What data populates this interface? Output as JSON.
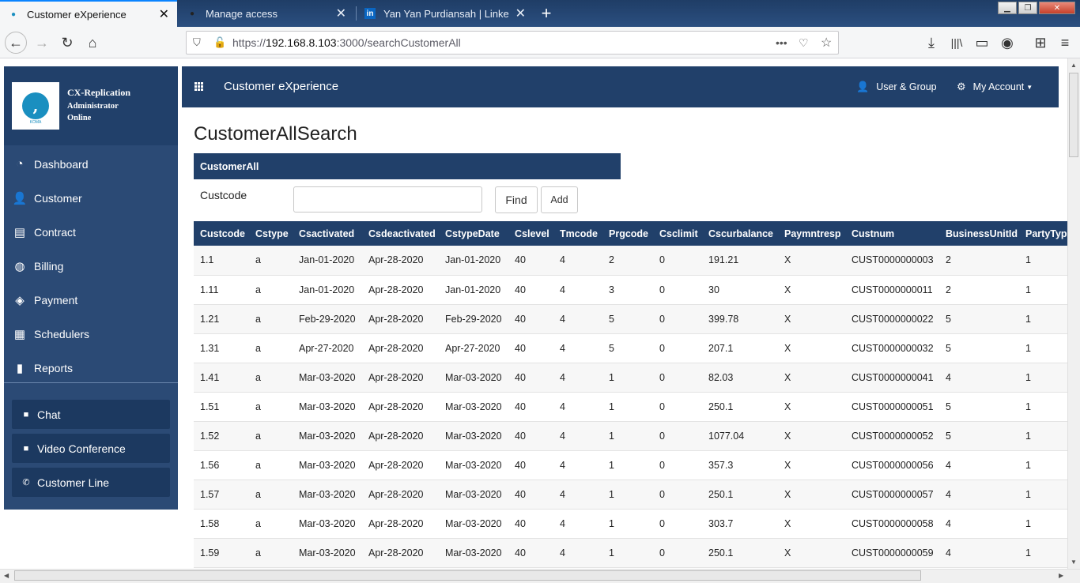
{
  "browser": {
    "tabs": [
      {
        "title": "Customer eXperience",
        "active": true
      },
      {
        "title": "Manage access",
        "active": false
      },
      {
        "title": "Yan Yan Purdiansah | LinkedIn",
        "active": false
      }
    ],
    "url_scheme": "https://",
    "url_host": "192.168.8.103",
    "url_path": ":3000/searchCustomerAll",
    "new_tab": "+"
  },
  "profile": {
    "name": "CX-Replication",
    "role": "Administrator",
    "status": "Online",
    "logo_mark": ",",
    "logo_text": "KOMA"
  },
  "sidebar": {
    "items": [
      {
        "label": "Dashboard",
        "icon": "dashboard-icon"
      },
      {
        "label": "Customer",
        "icon": "user-icon"
      },
      {
        "label": "Contract",
        "icon": "contract-icon"
      },
      {
        "label": "Billing",
        "icon": "globe-icon"
      },
      {
        "label": "Payment",
        "icon": "tags-icon"
      },
      {
        "label": "Schedulers",
        "icon": "calendar-icon"
      },
      {
        "label": "Reports",
        "icon": "bar-chart-icon"
      }
    ],
    "comm": [
      {
        "label": "Chat",
        "icon": "chat-icon"
      },
      {
        "label": "Video Conference",
        "icon": "video-icon"
      },
      {
        "label": "Customer Line",
        "icon": "phone-icon"
      }
    ]
  },
  "header": {
    "app_title": "Customer eXperience",
    "user_group": "User & Group",
    "my_account": "My Account"
  },
  "main": {
    "title": "CustomerAllSearch",
    "panel_title": "CustomerAll",
    "search_label": "Custcode",
    "search_value": "",
    "find_label": "Find",
    "add_label": "Add"
  },
  "table": {
    "columns": [
      "Custcode",
      "Cstype",
      "Csactivated",
      "Csdeactivated",
      "CstypeDate",
      "Cslevel",
      "Tmcode",
      "Prgcode",
      "Csclimit",
      "Cscurbalance",
      "Paymntresp",
      "Custnum",
      "BusinessUnitId",
      "PartyType"
    ],
    "rows": [
      [
        "1.1",
        "a",
        "Jan-01-2020",
        "Apr-28-2020",
        "Jan-01-2020",
        "40",
        "4",
        "2",
        "0",
        "191.21",
        "X",
        "CUST0000000003",
        "2",
        "1"
      ],
      [
        "1.11",
        "a",
        "Jan-01-2020",
        "Apr-28-2020",
        "Jan-01-2020",
        "40",
        "4",
        "3",
        "0",
        "30",
        "X",
        "CUST0000000011",
        "2",
        "1"
      ],
      [
        "1.21",
        "a",
        "Feb-29-2020",
        "Apr-28-2020",
        "Feb-29-2020",
        "40",
        "4",
        "5",
        "0",
        "399.78",
        "X",
        "CUST0000000022",
        "5",
        "1"
      ],
      [
        "1.31",
        "a",
        "Apr-27-2020",
        "Apr-28-2020",
        "Apr-27-2020",
        "40",
        "4",
        "5",
        "0",
        "207.1",
        "X",
        "CUST0000000032",
        "5",
        "1"
      ],
      [
        "1.41",
        "a",
        "Mar-03-2020",
        "Apr-28-2020",
        "Mar-03-2020",
        "40",
        "4",
        "1",
        "0",
        "82.03",
        "X",
        "CUST0000000041",
        "4",
        "1"
      ],
      [
        "1.51",
        "a",
        "Mar-03-2020",
        "Apr-28-2020",
        "Mar-03-2020",
        "40",
        "4",
        "1",
        "0",
        "250.1",
        "X",
        "CUST0000000051",
        "5",
        "1"
      ],
      [
        "1.52",
        "a",
        "Mar-03-2020",
        "Apr-28-2020",
        "Mar-03-2020",
        "40",
        "4",
        "1",
        "0",
        "1077.04",
        "X",
        "CUST0000000052",
        "5",
        "1"
      ],
      [
        "1.56",
        "a",
        "Mar-03-2020",
        "Apr-28-2020",
        "Mar-03-2020",
        "40",
        "4",
        "1",
        "0",
        "357.3",
        "X",
        "CUST0000000056",
        "4",
        "1"
      ],
      [
        "1.57",
        "a",
        "Mar-03-2020",
        "Apr-28-2020",
        "Mar-03-2020",
        "40",
        "4",
        "1",
        "0",
        "250.1",
        "X",
        "CUST0000000057",
        "4",
        "1"
      ],
      [
        "1.58",
        "a",
        "Mar-03-2020",
        "Apr-28-2020",
        "Mar-03-2020",
        "40",
        "4",
        "1",
        "0",
        "303.7",
        "X",
        "CUST0000000058",
        "4",
        "1"
      ],
      [
        "1.59",
        "a",
        "Mar-03-2020",
        "Apr-28-2020",
        "Mar-03-2020",
        "40",
        "4",
        "1",
        "0",
        "250.1",
        "X",
        "CUST0000000059",
        "4",
        "1"
      ]
    ]
  }
}
